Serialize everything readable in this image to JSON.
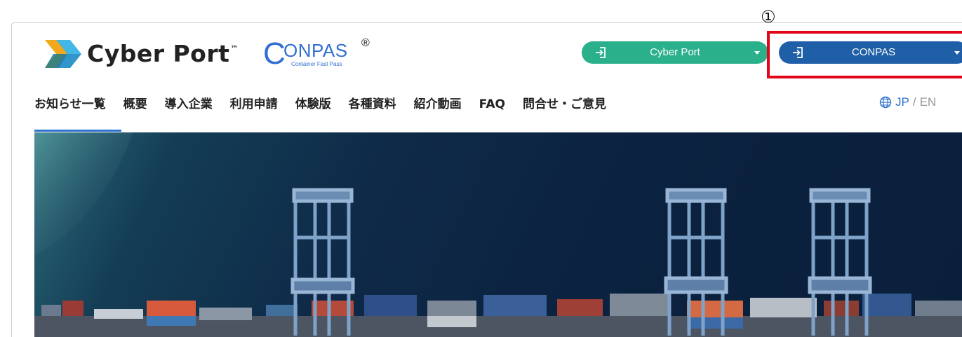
{
  "header": {
    "brand_name": "Cyber Port",
    "brand_tm": "™",
    "product_name_c": "C",
    "product_name_rest": "ONPAS",
    "product_reg": "®",
    "product_tagline": "Container Fast Pass"
  },
  "buttons": {
    "cyber_port_login": "Cyber Port",
    "conpas_login": "CONPAS"
  },
  "nav": {
    "items": [
      "お知らせ一覧",
      "概要",
      "導入企業",
      "利用申請",
      "体験版",
      "各種資料",
      "紹介動画",
      "FAQ",
      "問合せ・ご意見"
    ],
    "active_index": 0
  },
  "language": {
    "jp": "JP",
    "separator": "/",
    "en": "EN"
  },
  "annotation": {
    "marker": "①"
  },
  "colors": {
    "accent_blue": "#2f6fd0",
    "cyber_port_button": "#2bb08c",
    "conpas_button": "#1f5fa8",
    "callout_red": "#e3061a",
    "hero_dark": "#0b2240"
  },
  "icons": {
    "login": "login-icon",
    "language": "globe-icon",
    "dropdown": "caret-down-icon"
  }
}
